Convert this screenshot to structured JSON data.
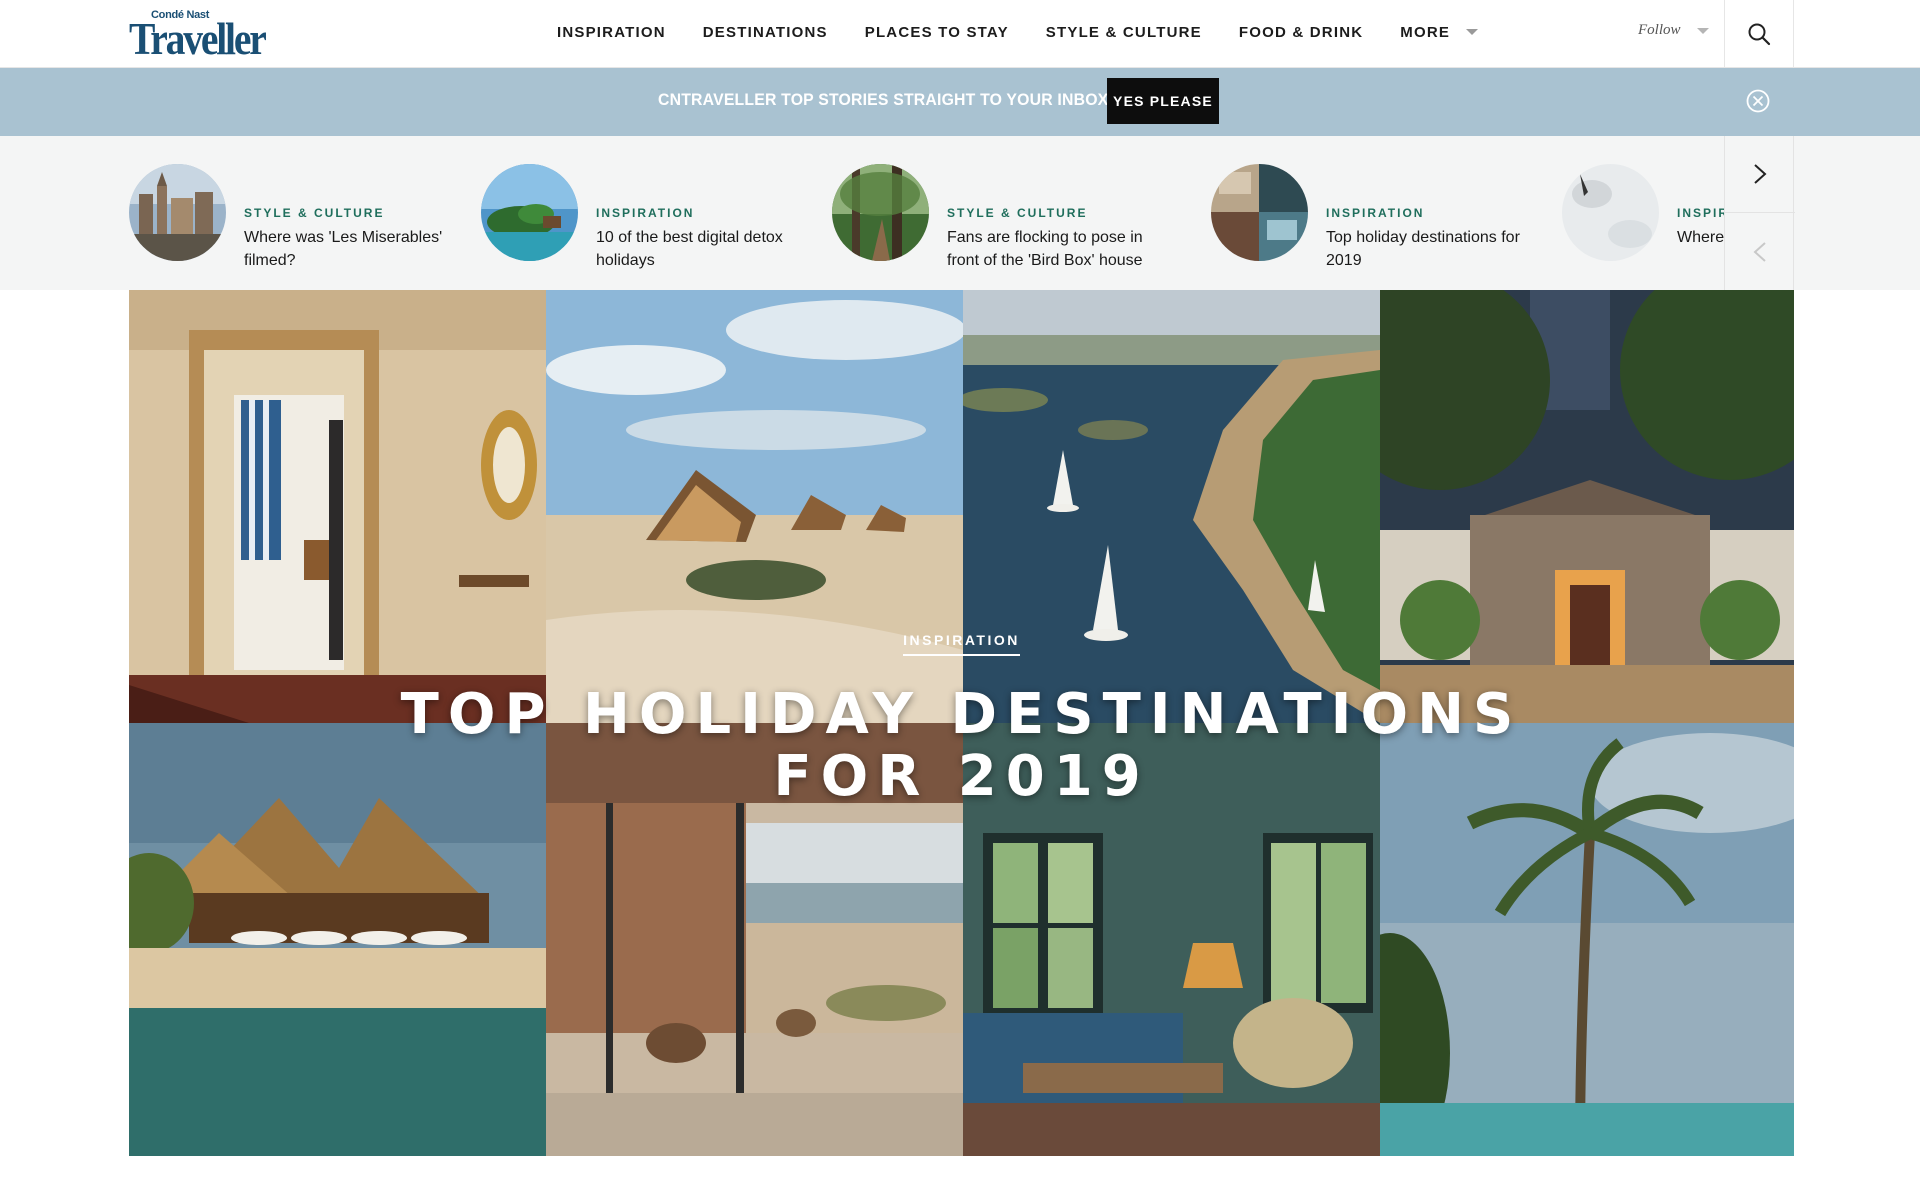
{
  "logo": {
    "small": "Condé Nast",
    "big": "Traveller"
  },
  "nav": {
    "items": [
      "INSPIRATION",
      "DESTINATIONS",
      "PLACES TO STAY",
      "STYLE & CULTURE",
      "FOOD & DRINK"
    ],
    "more": "MORE"
  },
  "follow": {
    "label": "Follow"
  },
  "banner": {
    "text": "CNTRAVELLER TOP STORIES STRAIGHT TO YOUR INBOX?",
    "button": "YES PLEASE"
  },
  "stories": [
    {
      "category": "STYLE & CULTURE",
      "title": "Where was 'Les Miserables' filmed?"
    },
    {
      "category": "INSPIRATION",
      "title": "10 of the best digital detox holidays"
    },
    {
      "category": "STYLE & CULTURE",
      "title": "Fans are flocking to pose in front of the 'Bird Box' house"
    },
    {
      "category": "INSPIRATION",
      "title": "Top holiday destinations for 2019"
    },
    {
      "category": "INSPIR",
      "title": "Where"
    }
  ],
  "hero": {
    "category": "INSPIRATION",
    "title_line1": "TOP HOLIDAY DESTINATIONS",
    "title_line2": "FOR 2019"
  },
  "colors": {
    "brand": "#1a4f74",
    "banner": "#a9c2d1",
    "category": "#1f6e5c",
    "strip_bg": "#f4f5f5"
  },
  "icons": {
    "search": "search-icon",
    "close": "close-circle-icon",
    "next": "chevron-right-icon",
    "prev": "chevron-left-icon",
    "dropdown": "caret-down-icon"
  }
}
